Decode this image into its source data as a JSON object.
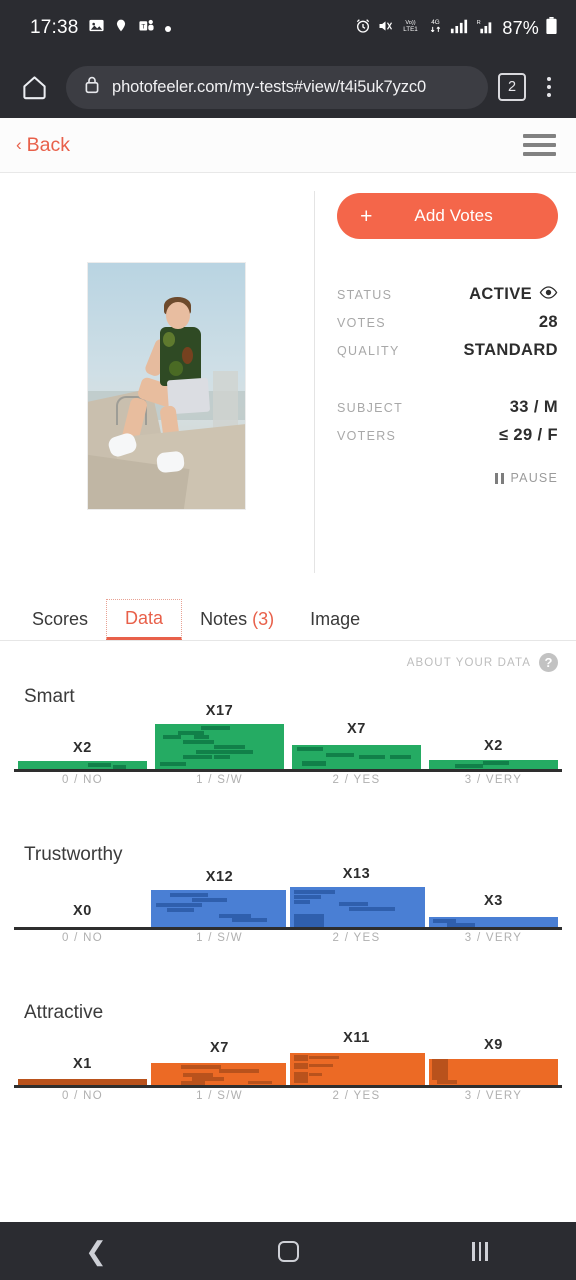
{
  "statusbar": {
    "time": "17:38",
    "battery": "87%",
    "icons_left": [
      "image-icon",
      "location-icon",
      "teams-icon",
      "dot-icon"
    ],
    "icons_right": [
      "alarm-icon",
      "mute-icon",
      "volte-icon",
      "4g-icon",
      "signal-icon",
      "signal-roaming-icon",
      "battery-icon"
    ]
  },
  "browser": {
    "url": "photofeeler.com/my-tests#view/t4i5uk7yzc0",
    "tab_count": "2",
    "home_icon": "home-icon",
    "lock_icon": "lock-icon",
    "menu_icon": "kebab-menu-icon"
  },
  "header": {
    "back_label": "Back",
    "menu_icon": "hamburger-icon"
  },
  "photo": {
    "alt": "man-sitting-on-concrete-blocks-photo"
  },
  "actions": {
    "add_votes_label": "Add Votes",
    "add_votes_plus": "+",
    "add_votes_color": "#f4664a",
    "pause_label": "PAUSE"
  },
  "stats": [
    {
      "key": "STATUS",
      "value": "ACTIVE",
      "icon": "eye-icon"
    },
    {
      "key": "VOTES",
      "value": "28"
    },
    {
      "key": "QUALITY",
      "value": "STANDARD"
    },
    {
      "key": "SUBJECT",
      "value": "33 / M"
    },
    {
      "key": "VOTERS",
      "value": "≤ 29 / F"
    }
  ],
  "tabs": [
    {
      "label": "Scores",
      "active": false
    },
    {
      "label": "Data",
      "active": true
    },
    {
      "label": "Notes",
      "count": "(3)",
      "active": false
    },
    {
      "label": "Image",
      "active": false
    }
  ],
  "about": {
    "label": "ABOUT YOUR DATA",
    "help_icon": "question-mark-icon"
  },
  "chart_data": [
    {
      "type": "bar",
      "title": "Smart",
      "categories": [
        "0 / NO",
        "1 / S/W",
        "2 / YES",
        "3 / VERY"
      ],
      "values": [
        2,
        17,
        7,
        2
      ],
      "labels": [
        "X2",
        "X17",
        "X7",
        "X2"
      ],
      "color": "#25ab63",
      "color_dark": "#118049",
      "xlabel": "",
      "ylabel": "",
      "ylim": [
        0,
        17
      ],
      "grid": false
    },
    {
      "type": "bar",
      "title": "Trustworthy",
      "categories": [
        "0 / NO",
        "1 / S/W",
        "2 / YES",
        "3 / VERY"
      ],
      "values": [
        0,
        12,
        13,
        3
      ],
      "labels": [
        "X0",
        "X12",
        "X13",
        "X3"
      ],
      "color": "#4a7fd4",
      "color_dark": "#2f5fad",
      "xlabel": "",
      "ylabel": "",
      "ylim": [
        0,
        13
      ],
      "grid": false
    },
    {
      "type": "bar",
      "title": "Attractive",
      "categories": [
        "0 / NO",
        "1 / S/W",
        "2 / YES",
        "3 / VERY"
      ],
      "values": [
        1,
        7,
        11,
        9
      ],
      "labels": [
        "X1",
        "X7",
        "X11",
        "X9"
      ],
      "color": "#ec6a25",
      "color_dark": "#b9521c",
      "xlabel": "",
      "ylabel": "",
      "ylim": [
        0,
        11
      ],
      "grid": false
    }
  ],
  "navbar": {
    "back_icon": "nav-back-icon",
    "home_icon": "nav-home-icon",
    "recents_icon": "nav-recents-icon"
  }
}
